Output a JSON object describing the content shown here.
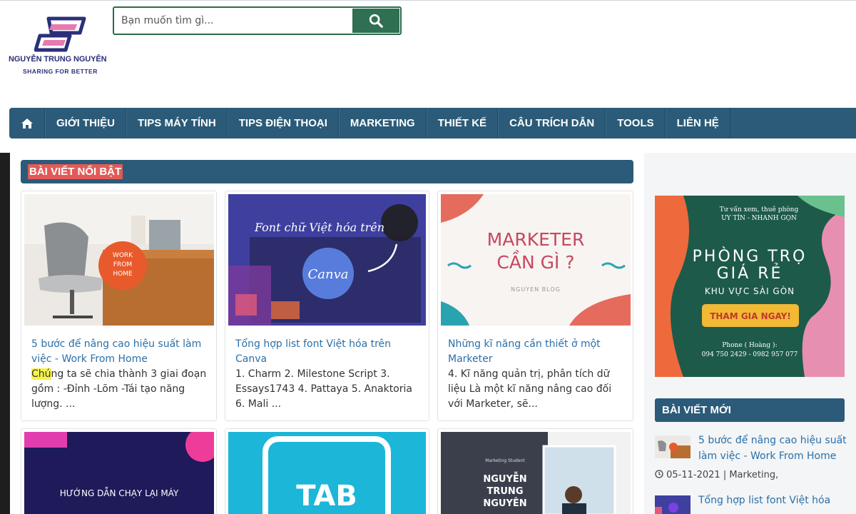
{
  "header": {
    "logo_name": "NGUYỄN TRUNG NGUYÊN",
    "logo_tagline": "SHARING FOR BETTER",
    "search_placeholder": "Bạn muốn tìm gì..."
  },
  "nav": {
    "items": [
      {
        "label": "GIỚI THIỆU"
      },
      {
        "label": "TIPS MÁY TÍNH"
      },
      {
        "label": "TIPS ĐIỆN THOẠI"
      },
      {
        "label": "MARKETING"
      },
      {
        "label": "THIẾT KẾ"
      },
      {
        "label": "CÂU TRÍCH DẪN"
      },
      {
        "label": "TOOLS"
      },
      {
        "label": "LIÊN HỆ"
      }
    ]
  },
  "featured": {
    "title": "BÀI VIẾT NỔI BẬT",
    "posts": [
      {
        "title": "5 bước để nâng cao hiệu suất làm việc - Work From Home",
        "snippet_highlight": "Chú",
        "snippet": "ng ta sẽ chia thành 3 giai đoạn gồm : -Đỉnh -Lõm -Tái tạo năng lượng. ...",
        "thumb_text": [
          "WORK",
          "FROM",
          "HOME"
        ]
      },
      {
        "title": "Tổng hợp list font Việt hóa trên Canva",
        "snippet": "1. Charm 2. Milestone Script 3. Essays1743 4. Pattaya 5. Anaktoria 6. Mali ...",
        "thumb_text": [
          "Font chữ Việt hóa trên",
          "Canva"
        ]
      },
      {
        "title": "Những kĩ năng cần thiết ở một Marketer",
        "snippet": "4. Kĩ năng quản trị, phân tích dữ liệu Là một kĩ năng nâng cao đối với Marketer, sẽ...",
        "thumb_text": [
          "MARKETER",
          "CẦN GÌ ?",
          "NGUYEN BLOG"
        ]
      },
      {
        "thumb_text": [
          "HƯỚNG DẪN CHẠY LẠI MÁY"
        ]
      },
      {
        "thumb_text": [
          "TAB"
        ]
      },
      {
        "thumb_text": [
          "Marketing Student",
          "NGUYỄN",
          "TRUNG",
          "NGUYÊN"
        ]
      }
    ]
  },
  "sidebar": {
    "ad": {
      "line1": "Tư vấn xem, thuê phòng",
      "line2": "UY TÍN - NHANH GỌN",
      "title1": "PHÒNG TRỌ",
      "title2": "GIÁ RẺ",
      "subtitle": "KHU VỰC SÀI GÒN",
      "cta": "THAM GIA NGAY!",
      "phone_label": "Phone ( Hoàng ):",
      "phones": "094 750 2429 - 0982 957 077"
    },
    "recent_title": "BÀI VIẾT MỚI",
    "recent": [
      {
        "title": "5 bước để nâng cao hiệu suất làm việc - Work From Home",
        "meta": "05-11-2021 | Marketing,"
      },
      {
        "title": "Tổng hợp list font Việt hóa"
      }
    ]
  },
  "colors": {
    "nav_bg": "#2b5b78",
    "search_btn": "#2f6f52",
    "section_title_bg": "#e25a57",
    "link": "#2b6fa8"
  },
  "icons": [
    "home-icon",
    "search-icon",
    "clock-icon"
  ]
}
